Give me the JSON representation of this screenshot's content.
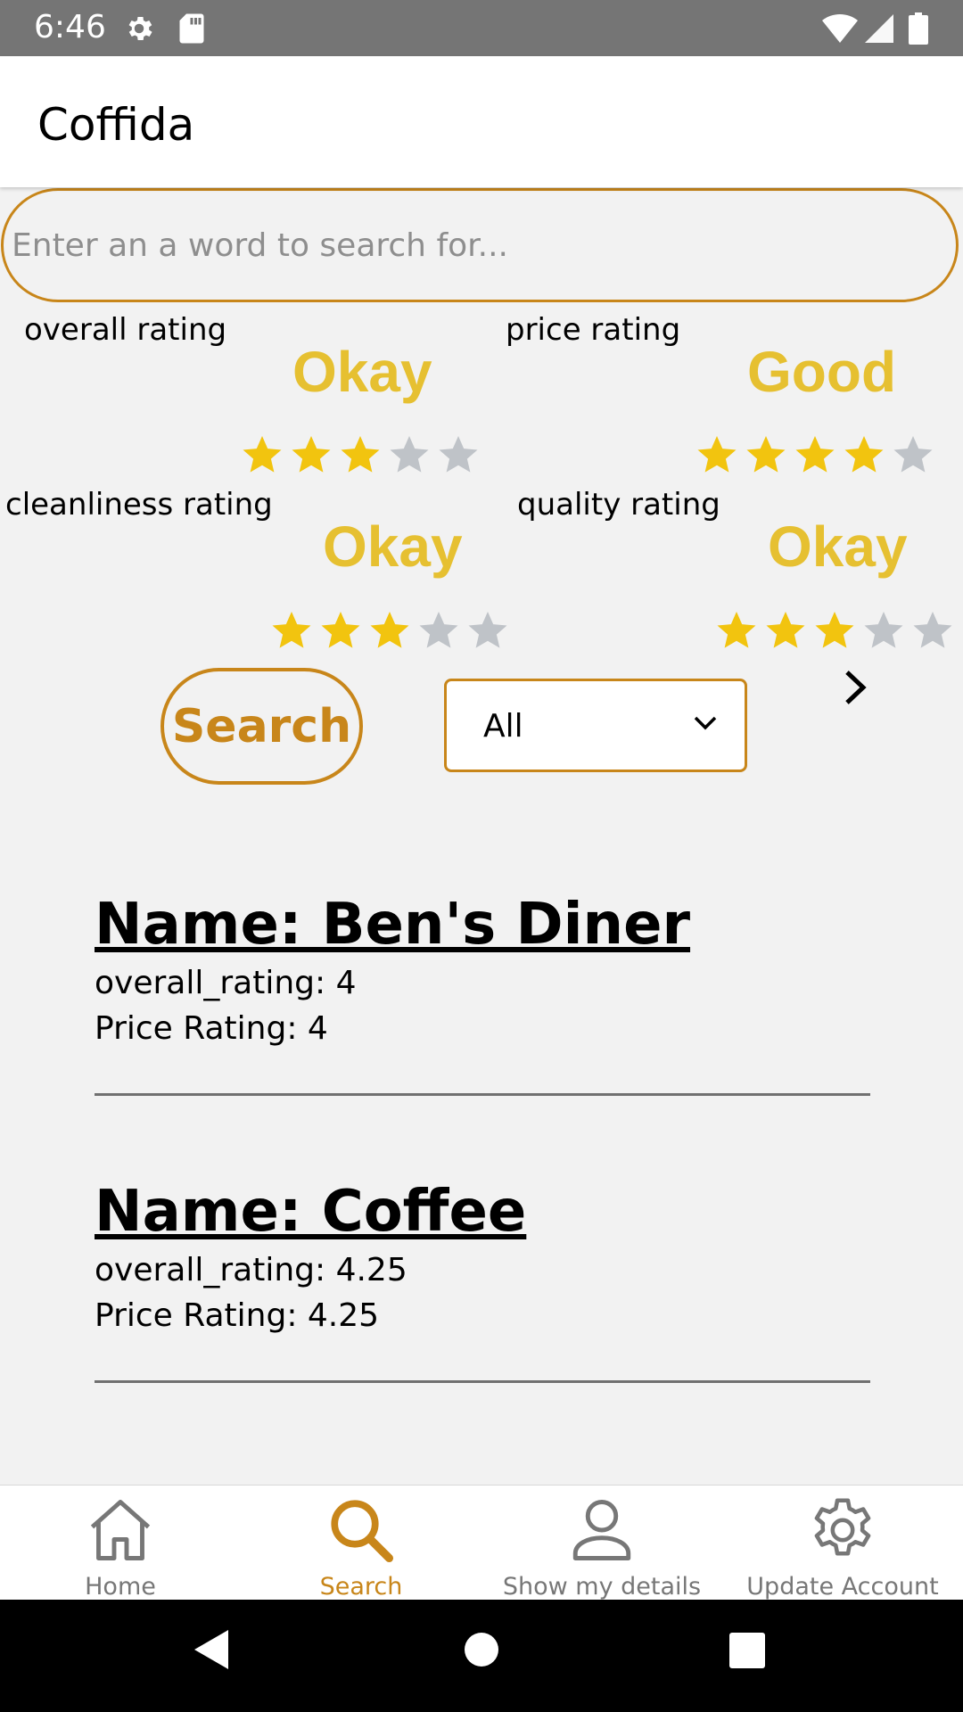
{
  "status_bar": {
    "time": "6:46",
    "icons": [
      "settings-icon",
      "sd-card-icon",
      "wifi-icon",
      "signal-icon",
      "battery-icon"
    ]
  },
  "app_bar": {
    "title": "Coffida"
  },
  "search": {
    "placeholder": "Enter an a word to search for..."
  },
  "ratings": {
    "overall": {
      "label": "overall rating",
      "word": "Okay",
      "stars": 3
    },
    "price": {
      "label": "price rating",
      "word": "Good",
      "stars": 4
    },
    "cleanliness": {
      "label": "cleanliness rating",
      "word": "Okay",
      "stars": 3
    },
    "quality": {
      "label": "quality rating",
      "word": "Okay",
      "stars": 3
    },
    "max_stars": 5
  },
  "controls": {
    "search_label": "Search",
    "filter_selected": "All"
  },
  "results": [
    {
      "name": "Name: Ben's Diner",
      "line1": "overall_rating: 4",
      "line2": "Price Rating: 4"
    },
    {
      "name": "Name: Coffee",
      "line1": "overall_rating: 4.25",
      "line2": "Price Rating: 4.25"
    }
  ],
  "bottom_nav": [
    {
      "label": "Home",
      "icon": "home-icon",
      "active": false
    },
    {
      "label": "Search",
      "icon": "search-icon",
      "active": true
    },
    {
      "label": "Show my details",
      "icon": "person-icon",
      "active": false
    },
    {
      "label": "Update Account",
      "icon": "gear-icon",
      "active": false
    }
  ],
  "colors": {
    "accent": "#c8861a",
    "rating_word": "#e6c031",
    "star_filled": "#f2c40f",
    "star_empty": "#bfc3c8"
  }
}
